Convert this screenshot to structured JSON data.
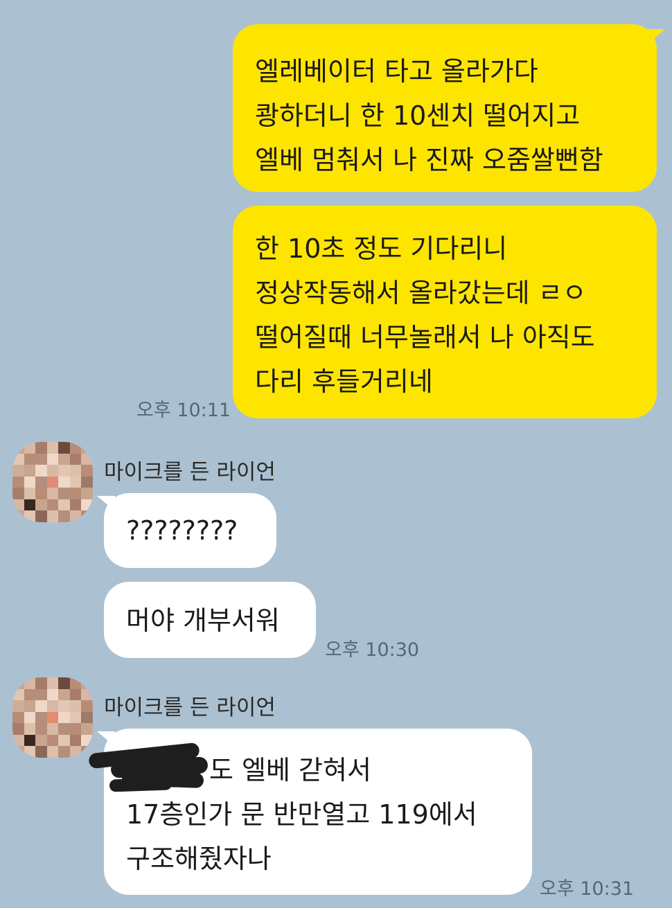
{
  "messages_out": {
    "m1": {
      "lines": [
        "엘레베이터 타고 올라가다",
        "쾅하더니 한 10센치 떨어지고",
        "엘베 멈춰서 나 진짜 오줌쌀뻔함"
      ]
    },
    "m2": {
      "lines": [
        "한 10초 정도 기다리니",
        "정상작동해서 올라갔는데 ㄹㅇ",
        "떨어질때 너무놀래서 나 아직도",
        "다리 후들거리네"
      ]
    },
    "time": "오후 10:11"
  },
  "group1": {
    "sender": "마이크를 든 라이언",
    "m1": {
      "lines": [
        "????????"
      ]
    },
    "m2": {
      "lines": [
        "머야 개부서워"
      ]
    },
    "time": "오후 10:30"
  },
  "group2": {
    "sender": "마이크를 든 라이언",
    "m1": {
      "lines": [
        "도 엘베 갇혀서",
        "17층인가 문 반만열고  119에서",
        "구조해줬자나"
      ]
    },
    "time": "오후 10:31"
  },
  "colors": {
    "background": "#abc1d1",
    "outgoing_bubble": "#fee500",
    "incoming_bubble": "#ffffff"
  },
  "icons": {
    "avatar": "pixelated-profile-photo"
  }
}
